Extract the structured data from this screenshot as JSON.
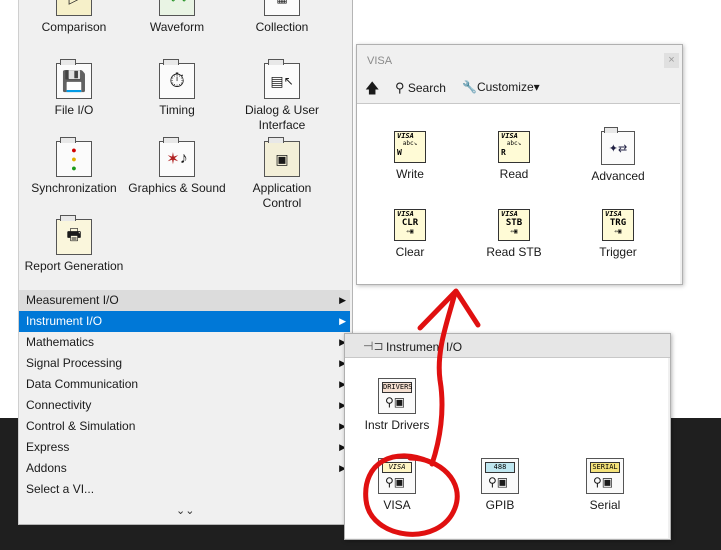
{
  "main_palette": {
    "tiles": [
      {
        "label": "Comparison",
        "icon": "comparison-icon"
      },
      {
        "label": "Waveform",
        "icon": "waveform-icon"
      },
      {
        "label": "Collection",
        "icon": "collection-icon"
      },
      {
        "label": "File I/O",
        "icon": "floppy-disk-icon"
      },
      {
        "label": "Timing",
        "icon": "stopwatch-icon"
      },
      {
        "label": "Dialog & User Interface",
        "icon": "dialog-icon"
      },
      {
        "label": "Synchronization",
        "icon": "traffic-light-icon"
      },
      {
        "label": "Graphics & Sound",
        "icon": "graphics-sound-icon"
      },
      {
        "label": "Application Control",
        "icon": "application-control-icon"
      },
      {
        "label": "Report Generation",
        "icon": "report-printer-icon"
      }
    ],
    "categories": [
      "Measurement I/O",
      "Instrument I/O",
      "Mathematics",
      "Signal Processing",
      "Data Communication",
      "Connectivity",
      "Control & Simulation",
      "Express",
      "Addons",
      "Select a VI..."
    ],
    "more_glyph": "⌄⌄"
  },
  "visa_palette": {
    "title": "VISA",
    "close_glyph": "×",
    "toolbar": {
      "up_glyph": "🡅",
      "search_label": "Search",
      "customize_label": "Customize▾"
    },
    "items": [
      {
        "label": "Write",
        "tag": "VISA",
        "code": "W"
      },
      {
        "label": "Read",
        "tag": "VISA",
        "code": "R"
      },
      {
        "label": "Advanced",
        "tag": "",
        "code": ""
      },
      {
        "label": "Clear",
        "tag": "VISA",
        "code": "CLR"
      },
      {
        "label": "Read STB",
        "tag": "VISA",
        "code": "STB"
      },
      {
        "label": "Trigger",
        "tag": "VISA",
        "code": "TRG"
      }
    ]
  },
  "instrument_palette": {
    "title": "Instrument I/O",
    "items": [
      {
        "label": "Instr Drivers",
        "tag": "DRIVERS"
      },
      {
        "label": "VISA",
        "tag": "VISA"
      },
      {
        "label": "GPIB",
        "tag": "488"
      },
      {
        "label": "Serial",
        "tag": "SERIAL"
      }
    ]
  },
  "colors": {
    "highlight": "#0078d7",
    "annotation": "#e01010"
  }
}
